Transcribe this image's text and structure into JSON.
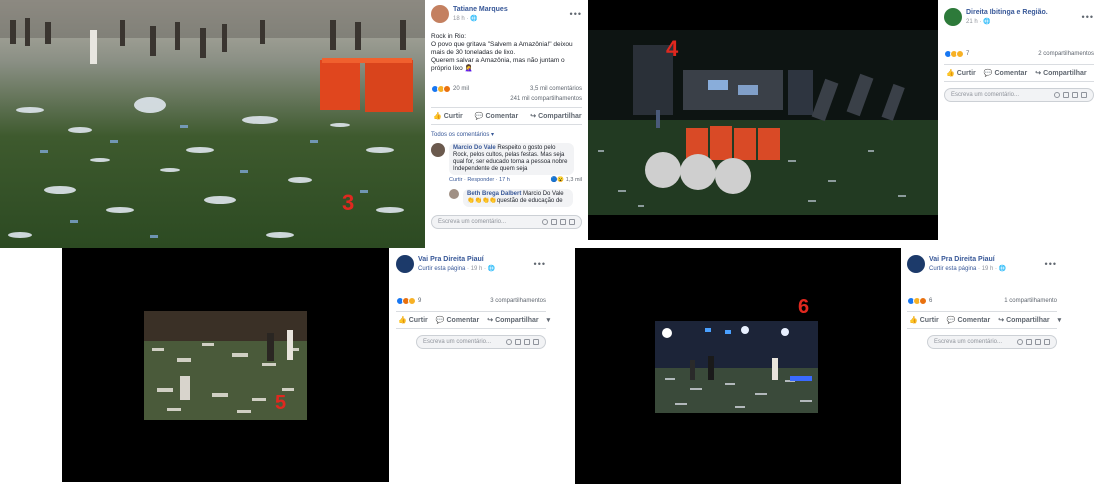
{
  "collage": {
    "numbers": {
      "n3": "3",
      "n4": "4",
      "n5": "5",
      "n6": "6"
    }
  },
  "post1": {
    "author": "Tatiane Marques",
    "time": "18 h",
    "text_line1": "Rock in Rio:",
    "text_line2": "O povo que gritava \"Salvem a Amazônia!\" deixou",
    "text_line3": "mais de 30 toneladas de lixo.",
    "text_line4": "Querem salvar a Amazônia, mas não juntam o",
    "text_line5": "próprio lixo 🤦‍♀️",
    "reactions": "20 mil",
    "comments": "3,5 mil comentários",
    "shares": "241 mil compartilhamentos",
    "like": "Curtir",
    "comment": "Comentar",
    "share": "Compartilhar",
    "all_comments": "Todos os comentários",
    "c1_author": "Marcio Do Vale",
    "c1_text1": "Respeito o gosto pelo",
    "c1_text2": "Rock, pelos cultos, pelas festas. Mas seja",
    "c1_text3": "qual for, ser educado torna a pessoa nobre",
    "c1_text4": "Independente de quem seja",
    "c1_reacts": "1,3 mil",
    "c1_actions": "Curtir · Responder · 17 h",
    "c2_author": "Beth Brega Dalbert",
    "c2_text1": "Marcio Do Vale",
    "c2_text2": "questão de educação de",
    "comment_placeholder": "Escreva um comentário..."
  },
  "post2": {
    "author": "Direita Ibitinga e Região.",
    "time": "21 h",
    "reactions": "7",
    "shares": "2 compartilhamentos",
    "like": "Curtir",
    "comment": "Comentar",
    "share": "Compartilhar",
    "comment_placeholder": "Escreva um comentário..."
  },
  "post3": {
    "author": "Vai Pra Direita Piauí",
    "sub": "Curtir esta página",
    "time": "19 h",
    "reactions": "9",
    "shares": "3 compartilhamentos",
    "like": "Curtir",
    "comment": "Comentar",
    "share": "Compartilhar",
    "comment_placeholder": "Escreva um comentário..."
  },
  "post4": {
    "author": "Vai Pra Direita Piauí",
    "sub": "Curtir esta página",
    "time": "19 h",
    "reactions": "6",
    "shares": "1 compartilhamento",
    "like": "Curtir",
    "comment": "Comentar",
    "share": "Compartilhar",
    "comment_placeholder": "Escreva um comentário..."
  },
  "colors": {
    "fb_blue": "#385898",
    "label_red": "#e0281f"
  }
}
